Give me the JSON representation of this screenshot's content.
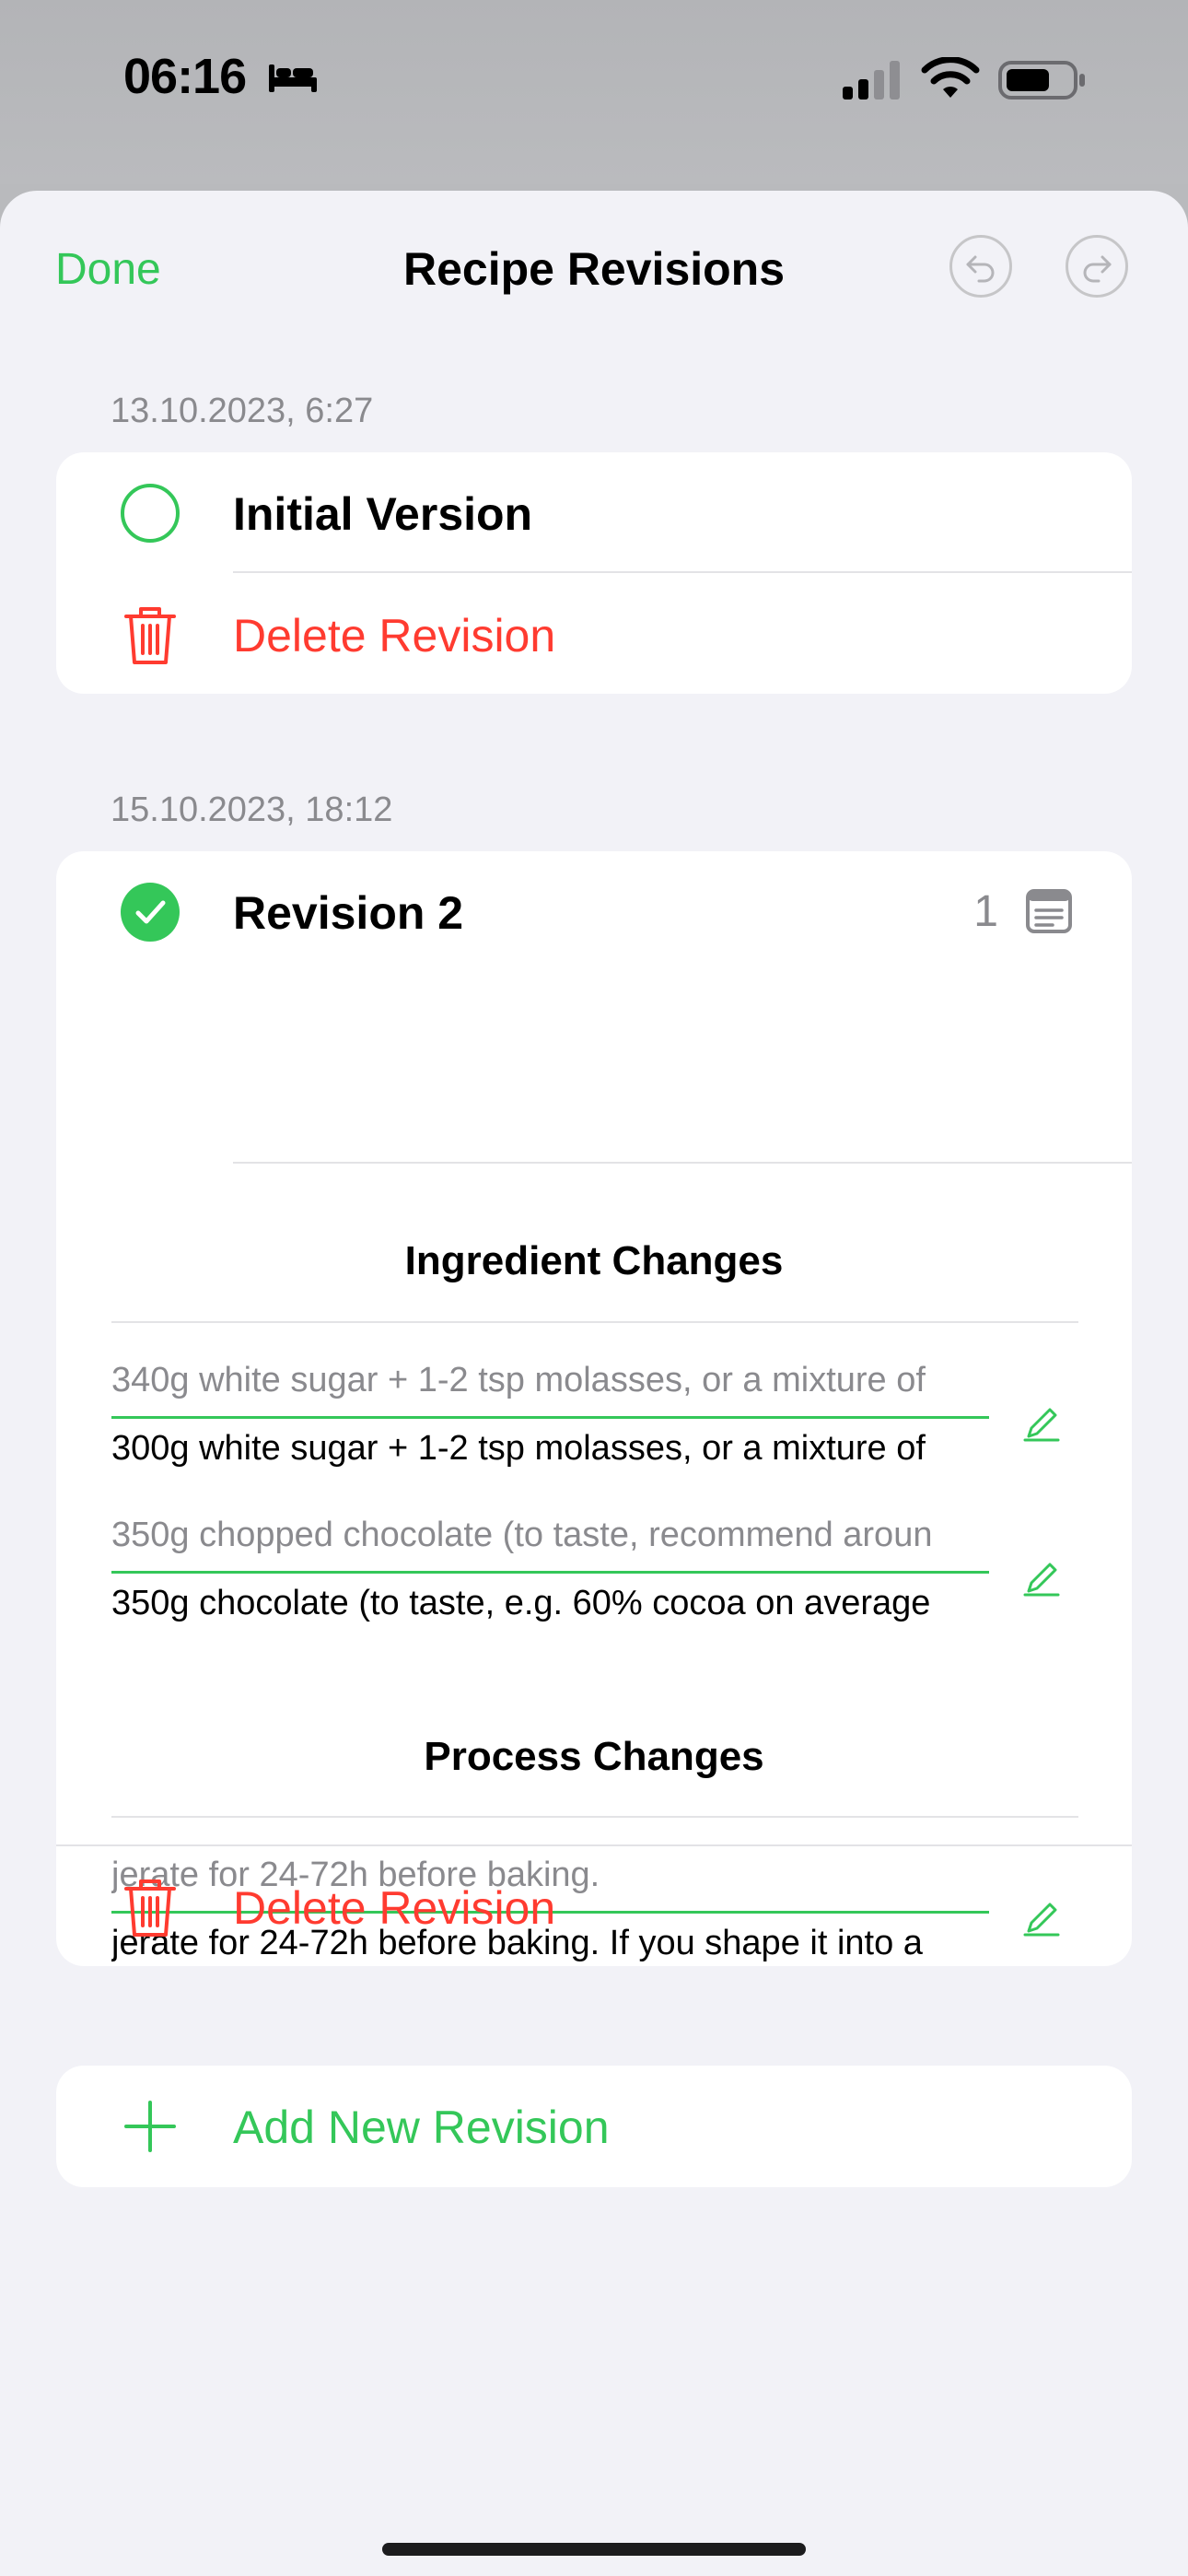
{
  "status_bar": {
    "time": "06:16",
    "icons": [
      "bed-icon",
      "cellular-signal-icon",
      "wifi-icon",
      "battery-icon"
    ]
  },
  "nav": {
    "done_label": "Done",
    "title": "Recipe Revisions",
    "undo_icon": "undo-icon",
    "redo_icon": "redo-icon"
  },
  "colors": {
    "accent": "#34c759",
    "destructive": "#ff3b30",
    "secondary_text": "#8a8a8e",
    "background": "#f2f2f7"
  },
  "revisions": [
    {
      "date": "13.10.2023, 6:27",
      "name": "Initial Version",
      "selected": false,
      "delete_label": "Delete Revision"
    },
    {
      "date": "15.10.2023, 18:12",
      "name": "Revision 2",
      "selected": true,
      "notes_count": "1",
      "ingredient_changes_title": "Ingredient Changes",
      "ingredient_changes": [
        {
          "old": "340g white sugar + 1-2 tsp molasses, or a mixture of",
          "new": "300g white sugar + 1-2 tsp molasses, or a mixture of"
        },
        {
          "old": "350g chopped chocolate (to taste, recommend aroun",
          "new": "350g chocolate (to taste, e.g. 60% cocoa on average"
        }
      ],
      "process_changes_title": "Process Changes",
      "process_changes": [
        {
          "old": "jerate for 24-72h before baking.",
          "new": "jerate for 24-72h before baking. If you shape it into a"
        }
      ],
      "delete_label": "Delete Revision"
    }
  ],
  "add_revision_label": "Add New Revision"
}
